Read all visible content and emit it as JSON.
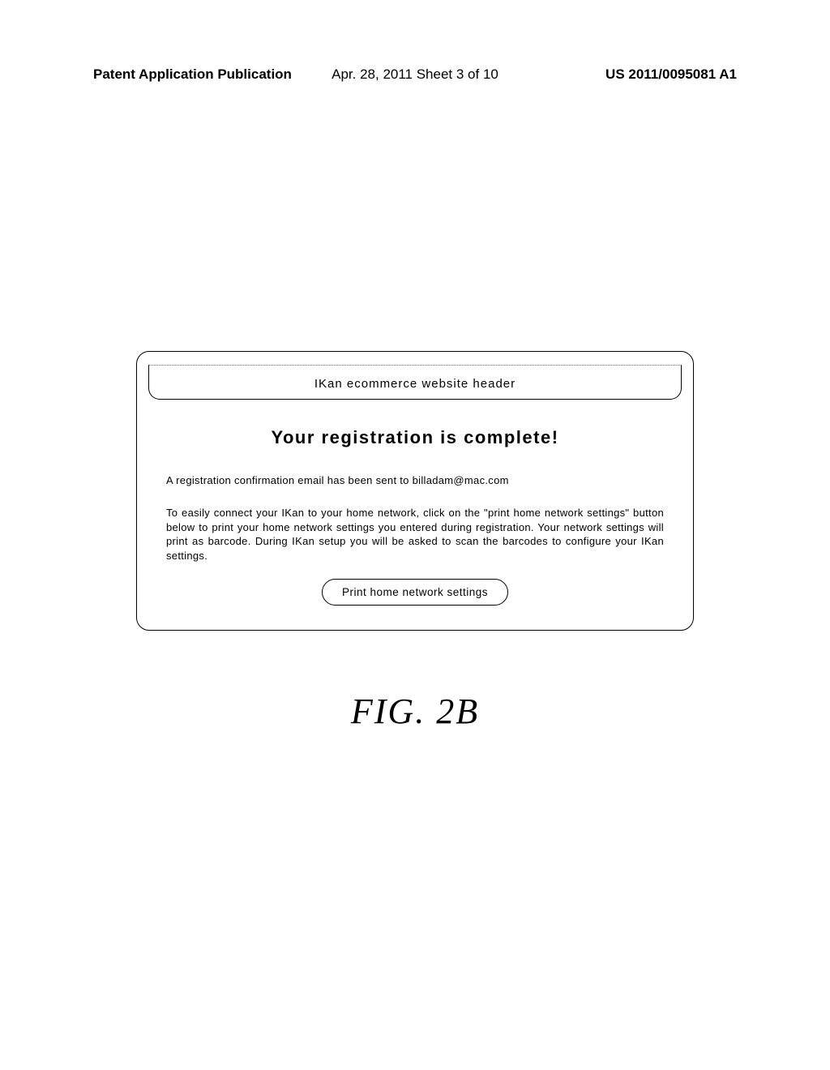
{
  "header": {
    "left": "Patent Application Publication",
    "center": "Apr. 28, 2011  Sheet 3 of 10",
    "right": "US 2011/0095081 A1"
  },
  "panel": {
    "website_header": "IKan  ecommerce  website  header",
    "title": "Your  registration  is  complete!",
    "confirmation_text": "A  registration  confirmation  email  has  been  sent  to  billadam@mac.com",
    "instruction_text": "To  easily  connect  your  IKan  to  your  home  network,  click  on  the  \"print  home  network  settings\" button  below  to  print  your  home  network  settings  you  entered  during  registration.  Your  network settings  will  print  as  barcode.  During  IKan  setup  you  will  be  asked  to  scan  the  barcodes  to configure  your  IKan  settings.",
    "button_label": "Print  home  network  settings"
  },
  "figure_label": "FIG.  2B"
}
